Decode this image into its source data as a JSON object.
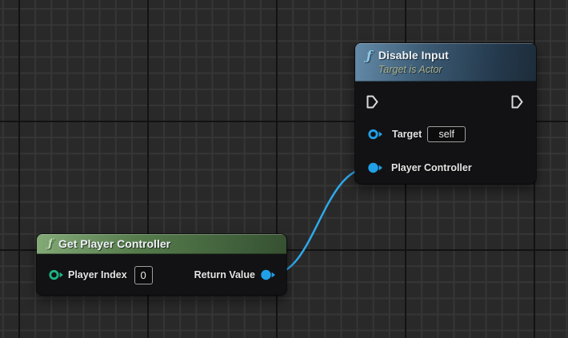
{
  "colors": {
    "wire": "#2fa8ec",
    "exec_pin": "#dadada",
    "object_pin": "#21a0e8",
    "int_pin": "#1db584",
    "blue_header": "#3c5b74",
    "green_header": "#567c4c",
    "node_body": "#121214",
    "grid_background": "#292929"
  },
  "icons": {
    "function_glyph": "ƒ"
  },
  "nodes": {
    "disable_input": {
      "title": "Disable Input",
      "subtitle": "Target is Actor",
      "pins": {
        "target": {
          "label": "Target",
          "value": "self"
        },
        "player_controller": {
          "label": "Player Controller"
        }
      }
    },
    "get_player_controller": {
      "title": "Get Player Controller",
      "pins": {
        "player_index": {
          "label": "Player Index",
          "value": "0"
        },
        "return_value": {
          "label": "Return Value"
        }
      }
    }
  }
}
